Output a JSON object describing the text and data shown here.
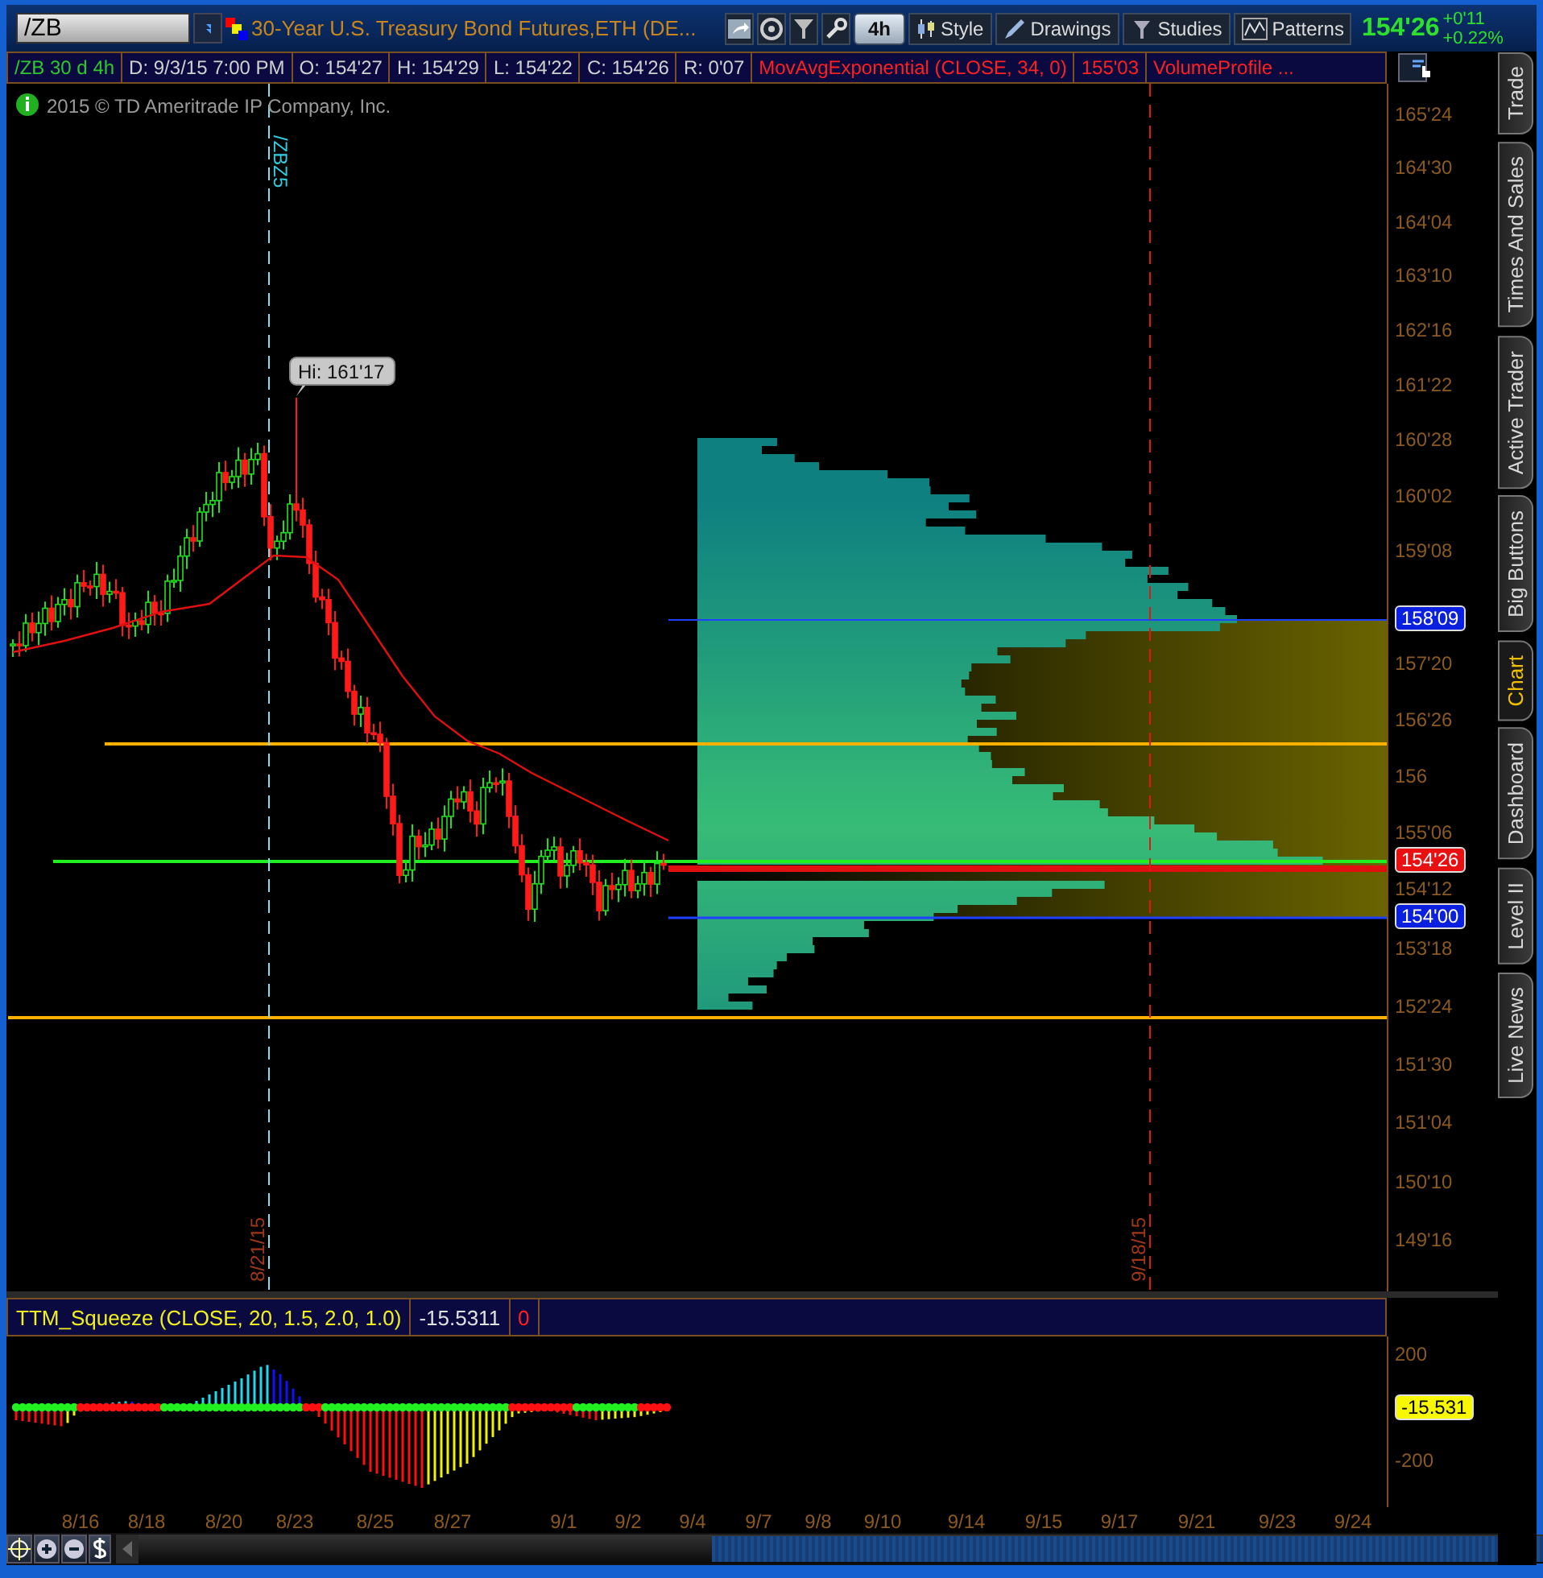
{
  "header": {
    "symbol": "/ZB",
    "description": "30-Year U.S. Treasury Bond Futures,ETH (DE...",
    "aggregation": "4h",
    "toolbar": [
      {
        "kind": "style",
        "label": "Style"
      },
      {
        "kind": "drawings",
        "label": "Drawings"
      },
      {
        "kind": "studies",
        "label": "Studies"
      },
      {
        "kind": "patterns",
        "label": "Patterns"
      }
    ],
    "last_price": "154'26",
    "net_change": "+0'11",
    "percent_change": "+0.22%"
  },
  "info_bar": [
    {
      "kind": "symbol",
      "text": "/ZB 30 d 4h"
    },
    {
      "kind": "field",
      "text": "D: 9/3/15 7:00 PM"
    },
    {
      "kind": "field",
      "text": "O: 154'27"
    },
    {
      "kind": "field",
      "text": "H: 154'29"
    },
    {
      "kind": "field",
      "text": "L: 154'22"
    },
    {
      "kind": "field",
      "text": "C: 154'26"
    },
    {
      "kind": "field",
      "text": "R: 0'07"
    },
    {
      "kind": "study",
      "text": "MovAvgExponential (CLOSE, 34, 0)"
    },
    {
      "kind": "study",
      "text": "155'03"
    },
    {
      "kind": "study",
      "text": "VolumeProfile ..."
    }
  ],
  "chart": {
    "copyright": "2015 © TD Ameritrade IP Company, Inc.",
    "high_label": "Hi: 161'17",
    "markers": [
      {
        "kind": "expiration",
        "top_label": "/ZBZ5",
        "bottom_label": "8/21/15"
      },
      {
        "kind": "event",
        "bottom_label": "9/18/15"
      }
    ]
  },
  "price_axis": [
    "165'24",
    "164'30",
    "164'04",
    "163'10",
    "162'16",
    "161'22",
    "160'28",
    "160'02",
    "159'08",
    "157'20",
    "156'26",
    "156",
    "155'06",
    "154'12",
    "153'18",
    "152'24",
    "151'30",
    "151'04",
    "150'10",
    "149'16"
  ],
  "price_badges": [
    {
      "text": "158'09",
      "color": "#0a1fe0"
    },
    {
      "text": "154'26",
      "color": "#e81010"
    },
    {
      "text": "154'00",
      "color": "#0a1fe0"
    }
  ],
  "lower_study": {
    "title": "TTM_Squeeze (CLOSE, 20, 1.5, 2.0, 1.0)",
    "value": "-15.5311",
    "signal": "0",
    "axis": [
      "200",
      "-200"
    ],
    "badge": "-15.531"
  },
  "time_axis": [
    "8/16",
    "8/18",
    "8/20",
    "8/23",
    "8/25",
    "8/27",
    "9/1",
    "9/2",
    "9/4",
    "9/7",
    "9/8",
    "9/10",
    "9/14",
    "9/15",
    "9/17",
    "9/21",
    "9/23",
    "9/24"
  ],
  "side_tabs": [
    {
      "label": "Trade",
      "selected": false
    },
    {
      "label": "Times And Sales",
      "selected": false
    },
    {
      "label": "Active Trader",
      "selected": false
    },
    {
      "label": "Big Buttons",
      "selected": false
    },
    {
      "label": "Chart",
      "selected": true
    },
    {
      "label": "Dashboard",
      "selected": false
    },
    {
      "label": "Level II",
      "selected": false
    },
    {
      "label": "Live News",
      "selected": false
    }
  ]
}
